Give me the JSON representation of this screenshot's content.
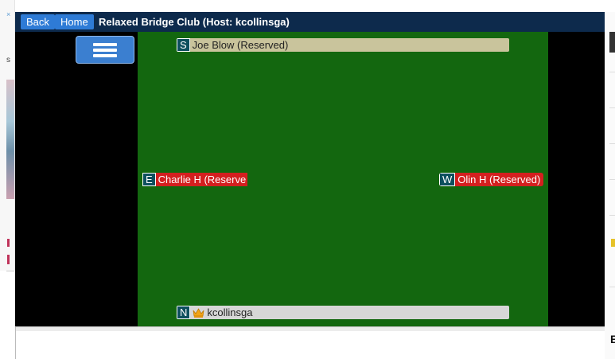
{
  "ad": {
    "close_glyph": "×",
    "letter": "s"
  },
  "nav": {
    "back_label": "Back",
    "home_label": "Home",
    "title": "Relaxed Bridge Club (Host: kcollinsga)"
  },
  "menu": {
    "icon": "hamburger-icon"
  },
  "seats": {
    "south": {
      "dir": "S",
      "name": "Joe Blow (Reserved)"
    },
    "east": {
      "dir": "E",
      "name": "Charlie H (Reserve"
    },
    "west": {
      "dir": "W",
      "name": "Olin H (Reserved)"
    },
    "north": {
      "dir": "N",
      "name": "kcollinsga",
      "host_icon": "crown-icon"
    }
  },
  "right_peek": {
    "letter": "E"
  },
  "colors": {
    "table_green": "#13670f",
    "nav_dark": "#0d2a4c",
    "button_blue": "#2e7bd6",
    "reserved_red": "#d41f1f"
  }
}
